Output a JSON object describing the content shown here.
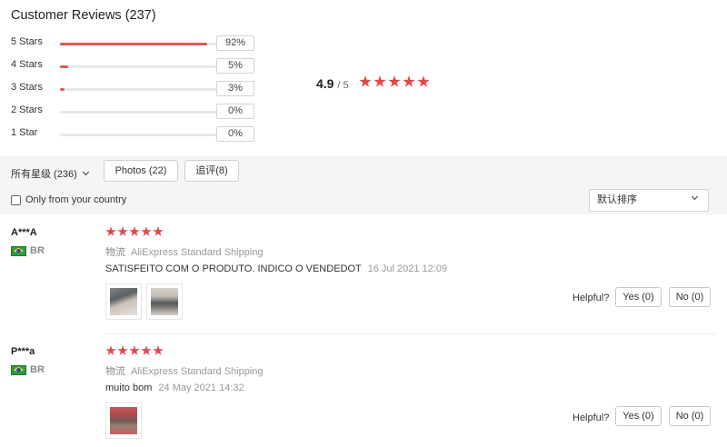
{
  "title": "Customer Reviews (237)",
  "histogram": [
    {
      "label": "5 Stars",
      "percent_text": "92%",
      "fraction": 0.92
    },
    {
      "label": "4 Stars",
      "percent_text": "5%",
      "fraction": 0.05
    },
    {
      "label": "3 Stars",
      "percent_text": "3%",
      "fraction": 0.03
    },
    {
      "label": "2 Stars",
      "percent_text": "0%",
      "fraction": 0.0
    },
    {
      "label": "1 Star",
      "percent_text": "0%",
      "fraction": 0.0
    }
  ],
  "average": {
    "value": "4.9",
    "out_of": "/ 5",
    "stars": 5
  },
  "filters": {
    "all_ratings": "所有星级 (236)",
    "photos": "Photos (22)",
    "additional": "追评(8)",
    "only_country": "Only from your country",
    "sort": "默认排序"
  },
  "reviews": [
    {
      "name": "A***A",
      "country": "BR",
      "stars": 5,
      "logistics_label": "物流",
      "shipping": "AliExpress Standard Shipping",
      "text": "SATISFEITO COM O PRODUTO. INDICO O VENDEDOT",
      "date": "16 Jul 2021 12:09",
      "helpful_label": "Helpful?",
      "yes": "Yes (0)",
      "no": "No (0)"
    },
    {
      "name": "P***a",
      "country": "BR",
      "stars": 5,
      "logistics_label": "物流",
      "shipping": "AliExpress Standard Shipping",
      "text": "muito bom",
      "date": "24 May 2021 14:32",
      "helpful_label": "Helpful?",
      "yes": "Yes (0)",
      "no": "No (0)"
    }
  ],
  "colors": {
    "accent": "#e0484b",
    "bar_fill": "#e05a5a",
    "track": "#e8e8e8"
  }
}
